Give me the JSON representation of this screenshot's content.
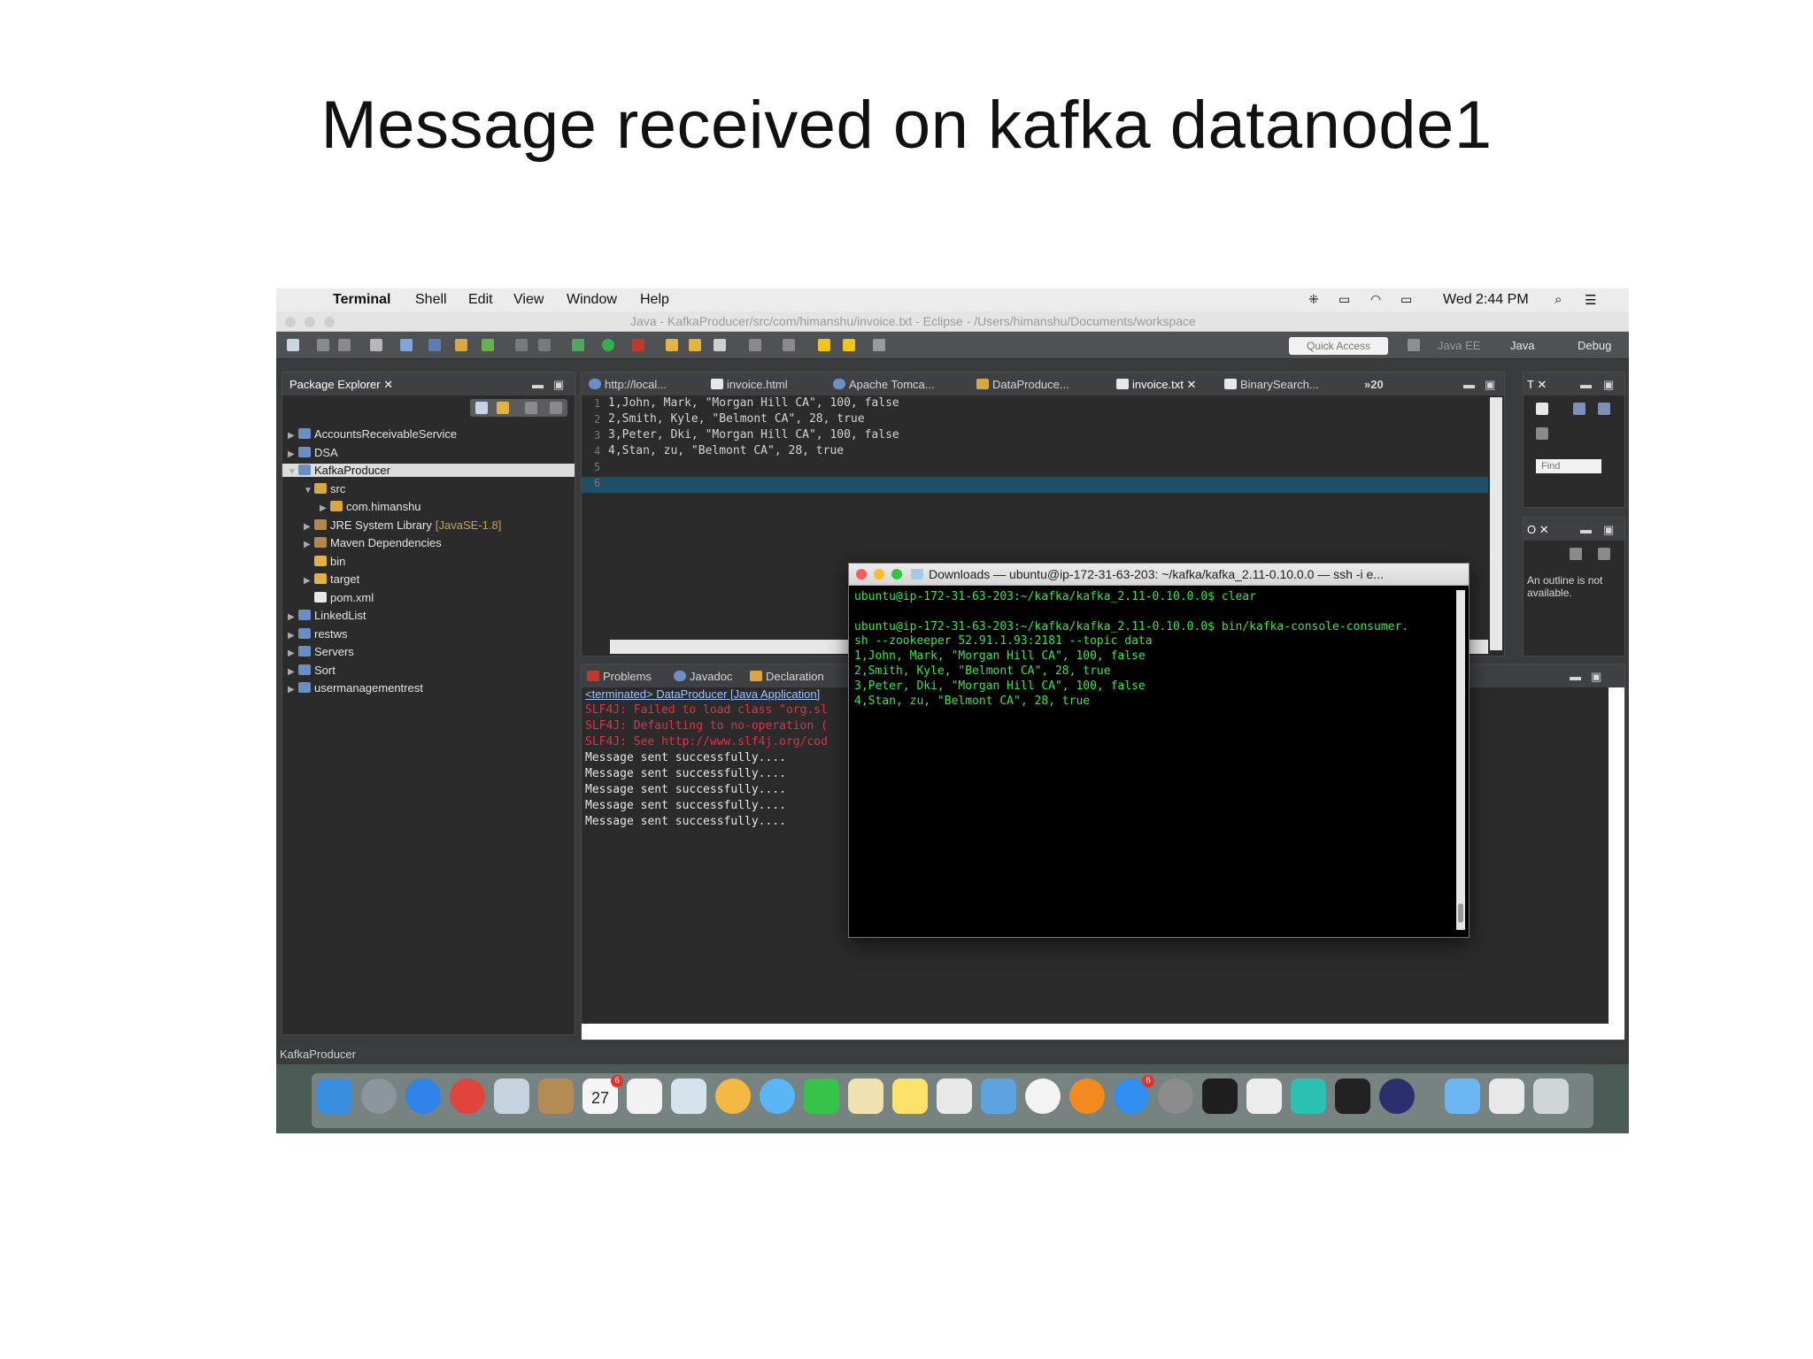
{
  "slide_title": "Message received on kafka datanode1",
  "menubar": {
    "app": "Terminal",
    "items": [
      "Shell",
      "Edit",
      "View",
      "Window",
      "Help"
    ],
    "clock": "Wed 2:44 PM"
  },
  "eclipse": {
    "window_title": "Java - KafkaProducer/src/com/himanshu/invoice.txt - Eclipse - /Users/himanshu/Documents/workspace",
    "quick_access_placeholder": "Quick Access",
    "perspectives": [
      "Java EE",
      "Java",
      "Debug"
    ],
    "package_explorer": {
      "tab": "Package Explorer",
      "tree": [
        {
          "label": "AccountsReceivableService",
          "depth": 0,
          "arrow": "▶"
        },
        {
          "label": "DSA",
          "depth": 0,
          "arrow": "▶"
        },
        {
          "label": "KafkaProducer",
          "depth": 0,
          "arrow": "▼",
          "selected": true
        },
        {
          "label": "src",
          "depth": 1,
          "arrow": "▼"
        },
        {
          "label": "com.himanshu",
          "depth": 2,
          "arrow": "▶"
        },
        {
          "label": "JRE System Library",
          "suffix": "[JavaSE-1.8]",
          "depth": 1,
          "arrow": "▶"
        },
        {
          "label": "Maven Dependencies",
          "depth": 1,
          "arrow": "▶"
        },
        {
          "label": "bin",
          "depth": 1,
          "arrow": ""
        },
        {
          "label": "target",
          "depth": 1,
          "arrow": "▶"
        },
        {
          "label": "pom.xml",
          "depth": 1,
          "arrow": ""
        },
        {
          "label": "LinkedList",
          "depth": 0,
          "arrow": "▶"
        },
        {
          "label": "restws",
          "depth": 0,
          "arrow": "▶"
        },
        {
          "label": "Servers",
          "depth": 0,
          "arrow": "▶"
        },
        {
          "label": "Sort",
          "depth": 0,
          "arrow": "▶"
        },
        {
          "label": "usermanagementrest",
          "depth": 0,
          "arrow": "▶"
        }
      ]
    },
    "editor_tabs": [
      "http://local...",
      "invoice.html",
      "Apache Tomca...",
      "DataProduce...",
      "invoice.txt",
      "BinarySearch..."
    ],
    "editor_overflow": "»20",
    "editor_lines": [
      "1,John, Mark, \"Morgan Hill CA\", 100, false",
      "2,Smith, Kyle, \"Belmont CA\", 28, true",
      "3,Peter, Dki, \"Morgan Hill CA\", 100, false",
      "4,Stan, zu, \"Belmont CA\", 28, true",
      "",
      ""
    ],
    "bottom_tabs": [
      "Problems",
      "Javadoc",
      "Declaration"
    ],
    "console_header": "<terminated> DataProducer [Java Application]",
    "console_lines": [
      {
        "text": "SLF4J: Failed to load class \"org.sl",
        "color": "#e0324a"
      },
      {
        "text": "SLF4J: Defaulting to no-operation (",
        "color": "#e0324a"
      },
      {
        "text": "SLF4J: See http://www.slf4j.org/cod",
        "color": "#e0324a"
      },
      {
        "text": "Message sent successfully....",
        "color": "#e6e6e6"
      },
      {
        "text": "Message sent successfully....",
        "color": "#e6e6e6"
      },
      {
        "text": "Message sent successfully....",
        "color": "#e6e6e6"
      },
      {
        "text": "Message sent successfully....",
        "color": "#e6e6e6"
      },
      {
        "text": "Message sent successfully....",
        "color": "#e6e6e6"
      }
    ],
    "right_panel_find_placeholder": "Find",
    "outline_text": "An outline is not available.",
    "status_text": "KafkaProducer"
  },
  "terminal": {
    "title": "Downloads — ubuntu@ip-172-31-63-203: ~/kafka/kafka_2.11-0.10.0.0 — ssh -i e...",
    "lines": [
      "ubuntu@ip-172-31-63-203:~/kafka/kafka_2.11-0.10.0.0$ clear",
      "",
      "ubuntu@ip-172-31-63-203:~/kafka/kafka_2.11-0.10.0.0$ bin/kafka-console-consumer.",
      "sh --zookeeper 52.91.1.93:2181 --topic data",
      "1,John, Mark, \"Morgan Hill CA\", 100, false",
      "2,Smith, Kyle, \"Belmont CA\", 28, true",
      "3,Peter, Dki, \"Morgan Hill CA\", 100, false",
      "4,Stan, zu, \"Belmont CA\", 28, true"
    ]
  },
  "dock": {
    "calendar_day": "27",
    "calendar_badge": "6",
    "appstore_badge": "6"
  },
  "colors": {
    "terminal_text": "#3ae64c",
    "error_text": "#e0324a",
    "highlight_line": "#1f4f66"
  }
}
